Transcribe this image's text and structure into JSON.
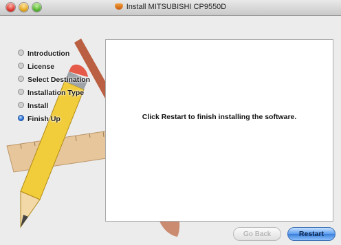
{
  "window": {
    "title": "Install MITSUBISHI CP9550D"
  },
  "steps": [
    {
      "label": "Introduction",
      "active": false
    },
    {
      "label": "License",
      "active": false
    },
    {
      "label": "Select Destination",
      "active": false
    },
    {
      "label": "Installation Type",
      "active": false
    },
    {
      "label": "Install",
      "active": false
    },
    {
      "label": "Finish Up",
      "active": true
    }
  ],
  "content": {
    "message": "Click Restart to finish installing the software."
  },
  "buttons": {
    "go_back": "Go Back",
    "restart": "Restart"
  },
  "colors": {
    "accent": "#3a7ed8"
  }
}
